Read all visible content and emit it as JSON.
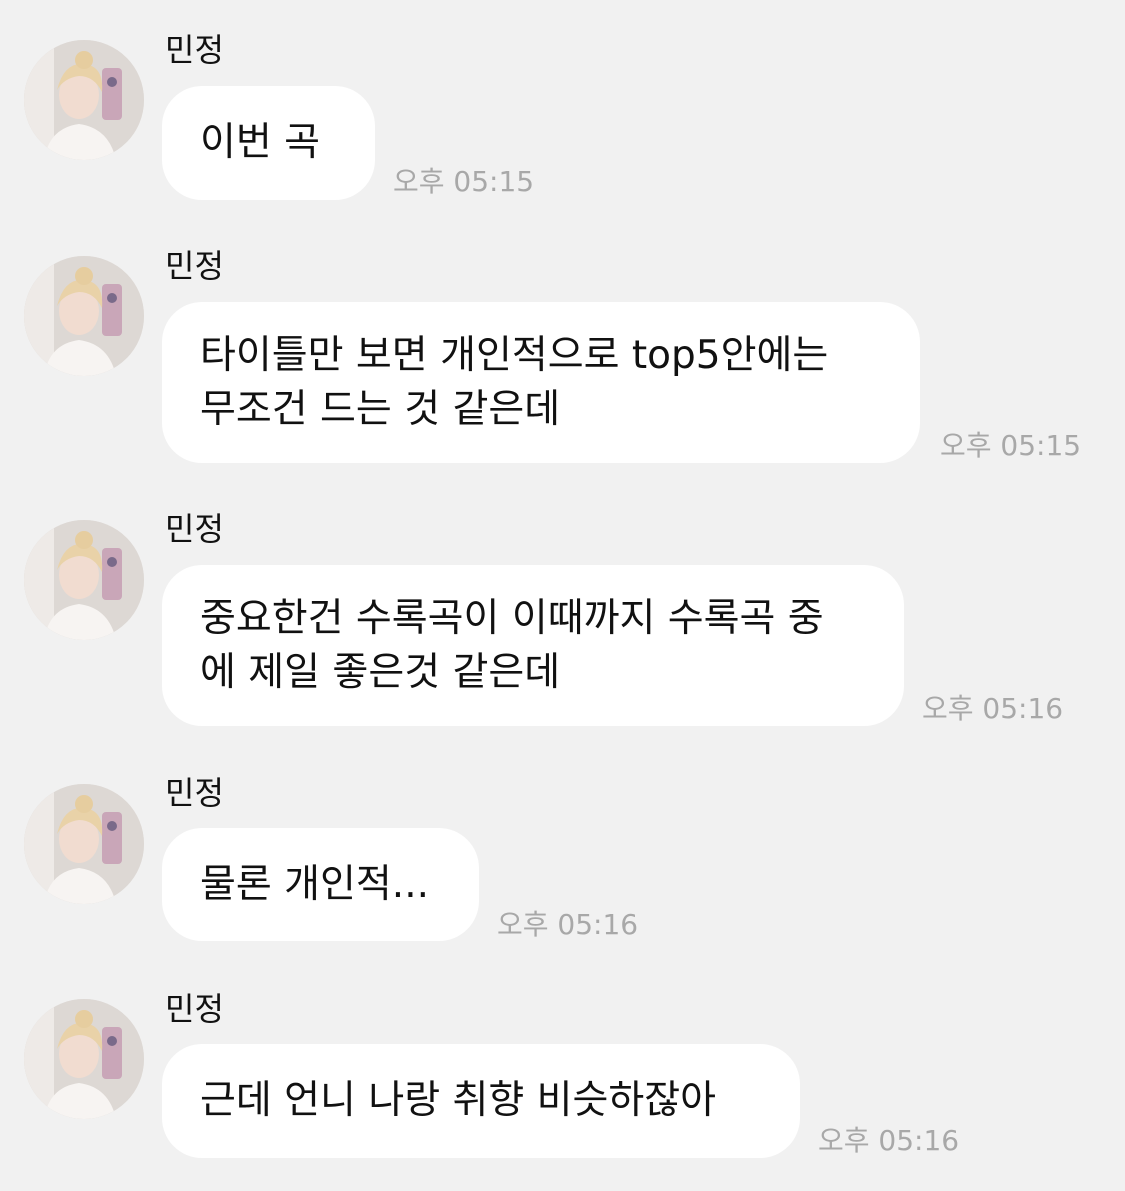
{
  "sender": "민정",
  "messages": [
    {
      "lines": [
        "이번 곡"
      ],
      "time": "오후 05:15"
    },
    {
      "lines": [
        "타이틀만 보면 개인적으로 top5안에는",
        "무조건 드는 것 같은데"
      ],
      "time": "오후 05:15"
    },
    {
      "lines": [
        "중요한건 수록곡이 이때까지 수록곡 중",
        "에 제일 좋은것 같은데"
      ],
      "time": "오후 05:16"
    },
    {
      "lines": [
        "물론 개인적..."
      ],
      "time": "오후 05:16"
    },
    {
      "lines": [
        "근데 언니 나랑 취향 비슷하잖아"
      ],
      "time": "오후 05:16"
    }
  ],
  "colors": {
    "background": "#f1f1f1",
    "bubble": "#ffffff",
    "text": "#111111",
    "timestamp": "#a8a8a8"
  },
  "icons": {
    "avatar": "profile-photo-avatar"
  }
}
